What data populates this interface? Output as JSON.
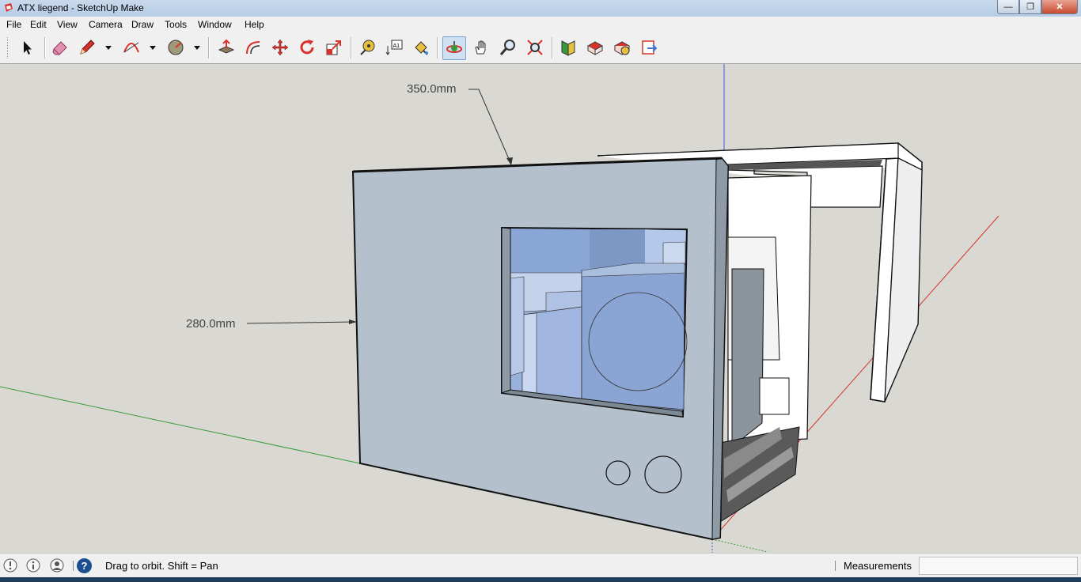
{
  "window": {
    "title": "ATX liegend - SketchUp Make",
    "minimize": "—",
    "maximize": "❐",
    "close": "✕"
  },
  "menu": [
    "File",
    "Edit",
    "View",
    "Camera",
    "Draw",
    "Tools",
    "Window",
    "Help"
  ],
  "toolbar": {
    "tools": [
      {
        "name": "select-tool-button",
        "icon": "arrow"
      },
      {
        "name": "eraser-tool-button",
        "icon": "eraser"
      },
      {
        "name": "pencil-tool-button",
        "icon": "pencil"
      },
      {
        "name": "arc-tool-button",
        "icon": "arc"
      },
      {
        "name": "shape-tool-button",
        "icon": "circle"
      },
      {
        "name": "pushpull-tool-button",
        "icon": "pushpull"
      },
      {
        "name": "offset-tool-button",
        "icon": "offset"
      },
      {
        "name": "move-tool-button",
        "icon": "move"
      },
      {
        "name": "rotate-tool-button",
        "icon": "rotate"
      },
      {
        "name": "scale-tool-button",
        "icon": "scale"
      },
      {
        "name": "tape-measure-tool-button",
        "icon": "tape"
      },
      {
        "name": "text-tool-button",
        "icon": "text"
      },
      {
        "name": "paint-bucket-tool-button",
        "icon": "paint"
      },
      {
        "name": "orbit-tool-button",
        "icon": "orbit",
        "active": true
      },
      {
        "name": "pan-tool-button",
        "icon": "hand"
      },
      {
        "name": "zoom-tool-button",
        "icon": "zoom"
      },
      {
        "name": "zoom-extents-tool-button",
        "icon": "extents"
      },
      {
        "name": "warehouse-button",
        "icon": "warehouse"
      },
      {
        "name": "share-model-button",
        "icon": "share"
      },
      {
        "name": "extension-warehouse-button",
        "icon": "extension"
      },
      {
        "name": "send-to-layout-button",
        "icon": "layout"
      }
    ],
    "text_tool_label": "A1"
  },
  "viewport": {
    "dimension_width": "350.0mm",
    "dimension_height": "280.0mm"
  },
  "status": {
    "text": "Drag to orbit.  Shift = Pan",
    "measurements_label": "Measurements",
    "measurements_value": "",
    "help_icon_label": "?"
  }
}
